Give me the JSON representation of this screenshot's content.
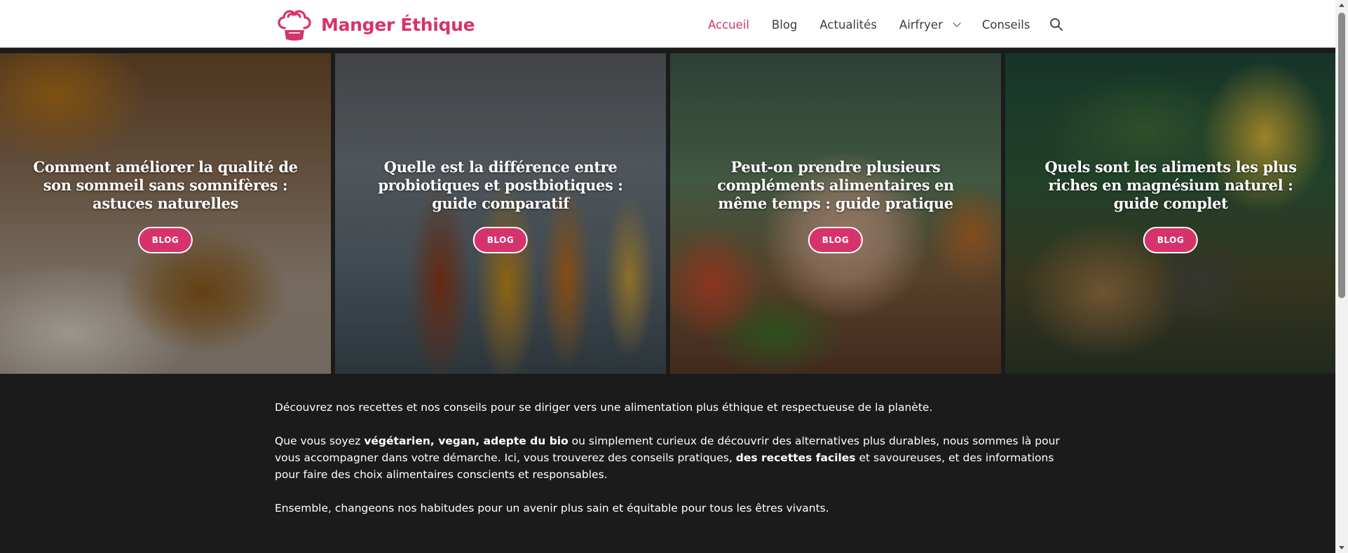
{
  "header": {
    "brand": "Manger Éthique",
    "nav": [
      {
        "label": "Accueil",
        "active": true
      },
      {
        "label": "Blog",
        "active": false
      },
      {
        "label": "Actualités",
        "active": false
      },
      {
        "label": "Airfryer",
        "active": false,
        "has_dropdown": true
      },
      {
        "label": "Conseils",
        "active": false
      }
    ],
    "search_icon": "search-icon"
  },
  "colors": {
    "accent": "#d6336c",
    "page_bg": "#1b1b1b",
    "header_bg": "#ffffff"
  },
  "cards": [
    {
      "title": "Comment améliorer la qualité de son sommeil sans somnifères : astuces naturelles",
      "tag": "BLOG"
    },
    {
      "title": "Quelle est la différence entre probiotiques et postbiotiques : guide comparatif",
      "tag": "BLOG"
    },
    {
      "title": "Peut-on prendre plusieurs compléments alimentaires en même temps : guide pratique",
      "tag": "BLOG"
    },
    {
      "title": "Quels sont les aliments les plus riches en magnésium naturel : guide complet",
      "tag": "BLOG"
    }
  ],
  "intro": {
    "p1": "Découvrez nos recettes et nos conseils pour se diriger vers une alimentation plus éthique et respectueuse de la planète.",
    "p2_a": "Que vous soyez ",
    "p2_b": "végétarien, vegan, adepte du bio",
    "p2_c": " ou simplement curieux de découvrir des alternatives plus durables, nous sommes là pour vous accompagner dans votre démarche. Ici, vous trouverez des conseils pratiques, ",
    "p2_d": "des recettes faciles",
    "p2_e": " et savoureuses, et des informations pour faire des choix alimentaires conscients et responsables.",
    "p3": "Ensemble, changeons nos habitudes pour un avenir plus sain et équitable pour tous les êtres vivants."
  }
}
